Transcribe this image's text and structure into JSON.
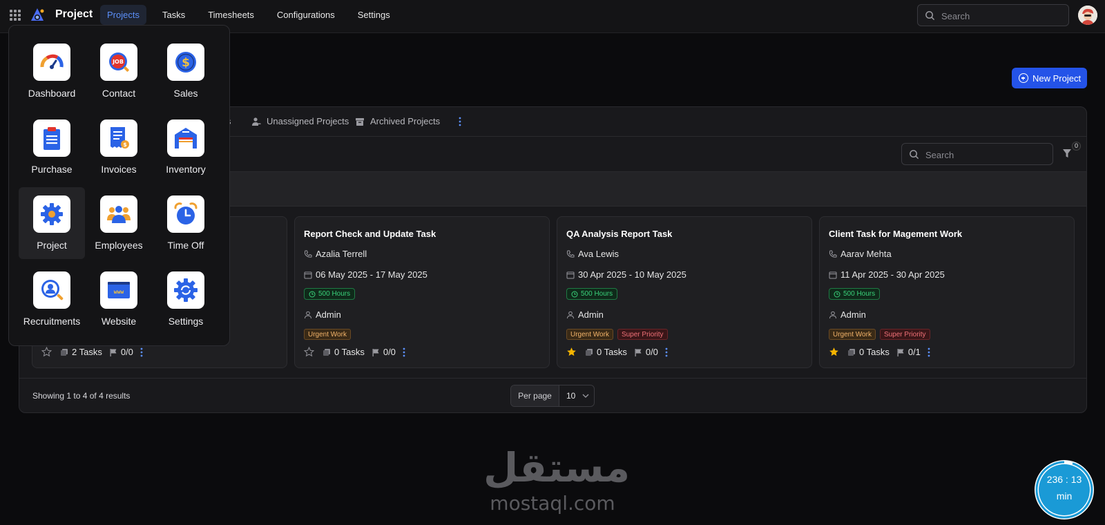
{
  "topbar": {
    "app_name": "Project",
    "nav": [
      "Projects",
      "Tasks",
      "Timesheets",
      "Configurations",
      "Settings"
    ],
    "active_nav": "Projects",
    "search_placeholder": "Search"
  },
  "actions": {
    "new_project": "New Project"
  },
  "tabs": {
    "partial": "s",
    "unassigned": "Unassigned Projects",
    "archived": "Archived Projects"
  },
  "panel_search_placeholder": "Search",
  "filter_count": "0",
  "launcher": {
    "apps": [
      {
        "label": "Dashboard",
        "icon": "gauge-icon"
      },
      {
        "label": "Contact",
        "icon": "job-contact-icon"
      },
      {
        "label": "Sales",
        "icon": "dollar-icon"
      },
      {
        "label": "Purchase",
        "icon": "clipboard-icon"
      },
      {
        "label": "Invoices",
        "icon": "receipt-icon"
      },
      {
        "label": "Inventory",
        "icon": "warehouse-icon"
      },
      {
        "label": "Project",
        "icon": "gear-icon"
      },
      {
        "label": "Employees",
        "icon": "users-icon"
      },
      {
        "label": "Time Off",
        "icon": "alarm-clock-icon"
      },
      {
        "label": "Recruitments",
        "icon": "recruit-search-icon"
      },
      {
        "label": "Website",
        "icon": "www-icon"
      },
      {
        "label": "Settings",
        "icon": "settings-cog-icon"
      }
    ],
    "active_app": "Project"
  },
  "cards": [
    {
      "title": "",
      "contact": "",
      "dates": "",
      "hours": "",
      "user": "",
      "tags": [],
      "starred": false,
      "tasks": "2 Tasks",
      "milestones": "0/0"
    },
    {
      "title": "Report Check and Update Task",
      "contact": "Azalia Terrell",
      "dates": "06 May 2025 - 17 May 2025",
      "hours": "500 Hours",
      "user": "Admin",
      "tags": [
        "Urgent Work"
      ],
      "starred": false,
      "tasks": "0 Tasks",
      "milestones": "0/0"
    },
    {
      "title": "QA Analysis Report Task",
      "contact": "Ava Lewis",
      "dates": "30 Apr 2025 - 10 May 2025",
      "hours": "500 Hours",
      "user": "Admin",
      "tags": [
        "Urgent Work",
        "Super Priority"
      ],
      "starred": true,
      "tasks": "0 Tasks",
      "milestones": "0/0"
    },
    {
      "title": "Client Task for Magement Work",
      "contact": "Aarav Mehta",
      "dates": "11 Apr 2025 - 30 Apr 2025",
      "hours": "500 Hours",
      "user": "Admin",
      "tags": [
        "Urgent Work",
        "Super Priority"
      ],
      "starred": true,
      "tasks": "0 Tasks",
      "milestones": "0/1"
    }
  ],
  "footer": {
    "showing": "Showing 1 to 4 of 4 results",
    "per_page_label": "Per page",
    "per_page_value": "10"
  },
  "watermark": {
    "arabic": "مستقل",
    "latin": "mostaql.com"
  },
  "timer": {
    "time": "236 : 13",
    "unit": "min"
  },
  "colors": {
    "accent": "#2453e8",
    "nav_active": "#5b8ff9",
    "hours_green": "#3ad17a",
    "star": "#f5b400",
    "timer_blue": "#1a9ad6"
  }
}
